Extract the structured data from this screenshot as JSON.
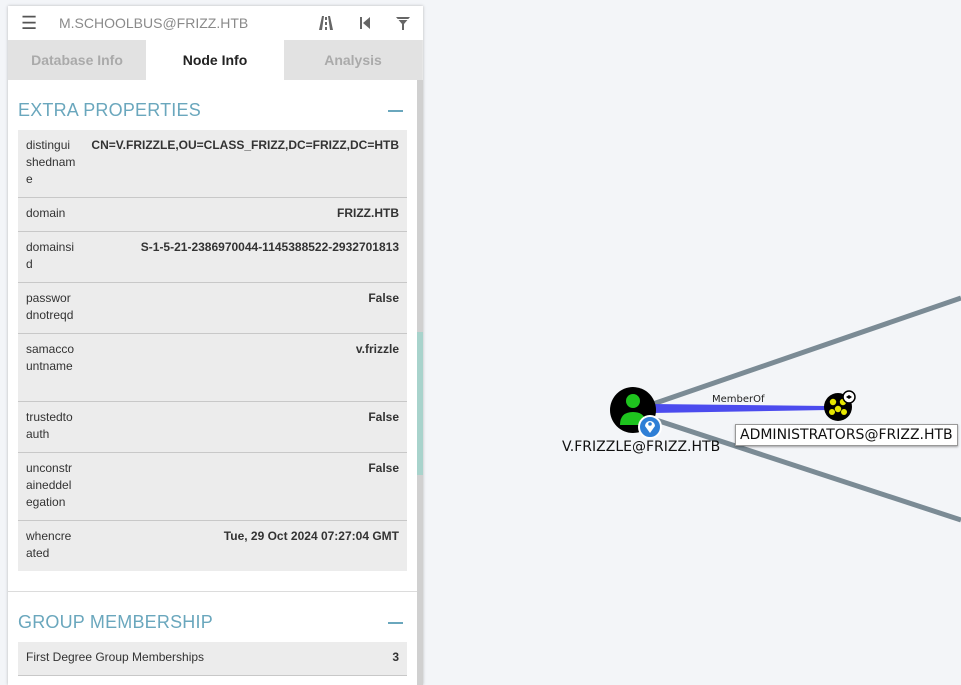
{
  "search": {
    "value": "M.SCHOOLBUS@FRIZZ.HTB"
  },
  "tabs": [
    {
      "label": "Database Info",
      "active": false
    },
    {
      "label": "Node Info",
      "active": true
    },
    {
      "label": "Analysis",
      "active": false
    }
  ],
  "extra_properties": {
    "title": "EXTRA PROPERTIES",
    "rows": [
      {
        "key": "distinguishedname",
        "value": "CN=V.FRIZZLE,OU=CLASS_FRIZZ,DC=FRIZZ,DC=HTB"
      },
      {
        "key": "domain",
        "value": "FRIZZ.HTB"
      },
      {
        "key": "domainsid",
        "value": "S-1-5-21-2386970044-1145388522-2932701813"
      },
      {
        "key": "passwordnotreqd",
        "value": "False"
      },
      {
        "key": "samaccountname",
        "value": "v.frizzle"
      },
      {
        "key": "trustedtoauth",
        "value": "False"
      },
      {
        "key": "unconstraineddelegation",
        "value": "False"
      },
      {
        "key": "whencreated",
        "value": "Tue, 29 Oct 2024 07:27:04 GMT"
      }
    ]
  },
  "group_membership": {
    "title": "GROUP MEMBERSHIP",
    "rows": [
      {
        "key": "First Degree Group Memberships",
        "value": "3"
      }
    ]
  },
  "graph": {
    "user_node": {
      "label": "V.FRIZZLE@FRIZZ.HTB",
      "icon": "user-icon",
      "color": "#1ec41e"
    },
    "group_node": {
      "label": "ADMINISTRATORS@FRIZZ.HTB",
      "icon": "group-icon",
      "color": "#e6e600"
    },
    "edge": {
      "label": "MemberOf",
      "color": "#4a4af0"
    },
    "edge_color_other": "#7a8a94"
  },
  "colors": {
    "accent": "#6aa7bd",
    "scroll_thumb": "#a8d3cc"
  }
}
